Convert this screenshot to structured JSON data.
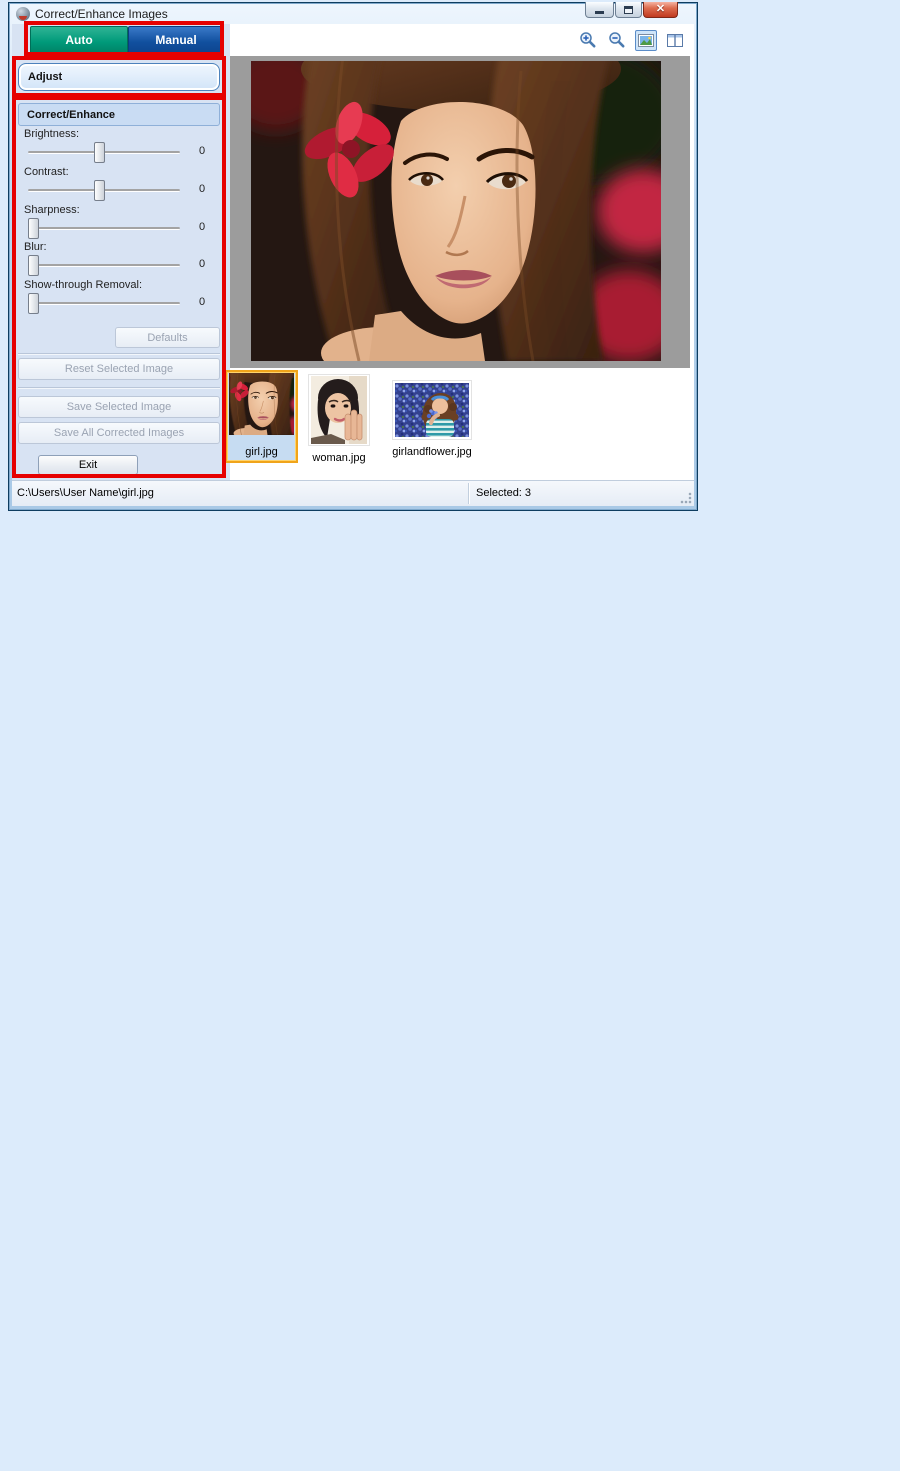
{
  "window": {
    "title": "Correct/Enhance Images",
    "icon": "app-face-icon",
    "controls": [
      {
        "name": "minimize"
      },
      {
        "name": "restore"
      },
      {
        "name": "close"
      }
    ]
  },
  "tabs": [
    {
      "label": "Auto",
      "active": false,
      "color": "#009a7a"
    },
    {
      "label": "Manual",
      "active": true,
      "color": "#11509f"
    }
  ],
  "panel": {
    "adjust_label": "Adjust",
    "correct_enhance_label": "Correct/Enhance",
    "sliders": [
      {
        "label": "Brightness:",
        "value": "0",
        "thumb_position": "center"
      },
      {
        "label": "Contrast:",
        "value": "0",
        "thumb_position": "center"
      },
      {
        "label": "Sharpness:",
        "value": "0",
        "thumb_position": "left"
      },
      {
        "label": "Blur:",
        "value": "0",
        "thumb_position": "left"
      },
      {
        "label": "Show-through Removal:",
        "value": "0",
        "thumb_position": "left"
      }
    ],
    "buttons": {
      "defaults": {
        "label": "Defaults",
        "enabled": false
      },
      "reset_selected": {
        "label": "Reset Selected Image",
        "enabled": false
      },
      "save_selected": {
        "label": "Save Selected Image",
        "enabled": false
      },
      "save_all": {
        "label": "Save All Corrected Images",
        "enabled": false
      },
      "exit": {
        "label": "Exit",
        "enabled": true
      }
    }
  },
  "toolbar": {
    "icons": [
      {
        "name": "zoom-in-icon",
        "selected": false
      },
      {
        "name": "zoom-out-icon",
        "selected": false
      },
      {
        "name": "whole-image-view-icon",
        "selected": true
      },
      {
        "name": "compare-view-icon",
        "selected": false
      }
    ]
  },
  "preview": {
    "description": "close-up portrait of a woman with a red flower in her brown hair"
  },
  "thumbnails": [
    {
      "label": "girl.jpg",
      "selected": true
    },
    {
      "label": "woman.jpg",
      "selected": false
    },
    {
      "label": "girlandflower.jpg",
      "selected": false
    }
  ],
  "statusbar": {
    "path": "C:\\Users\\User Name\\girl.jpg",
    "selected_count_label": "Selected: 3"
  },
  "colors": {
    "page_bg": "#dcebfb",
    "panel_bg": "#d8e3f3",
    "preview_bg": "#9c9c9c",
    "annotation_red": "#e60000",
    "selected_thumb_border": "#f0a41a"
  }
}
